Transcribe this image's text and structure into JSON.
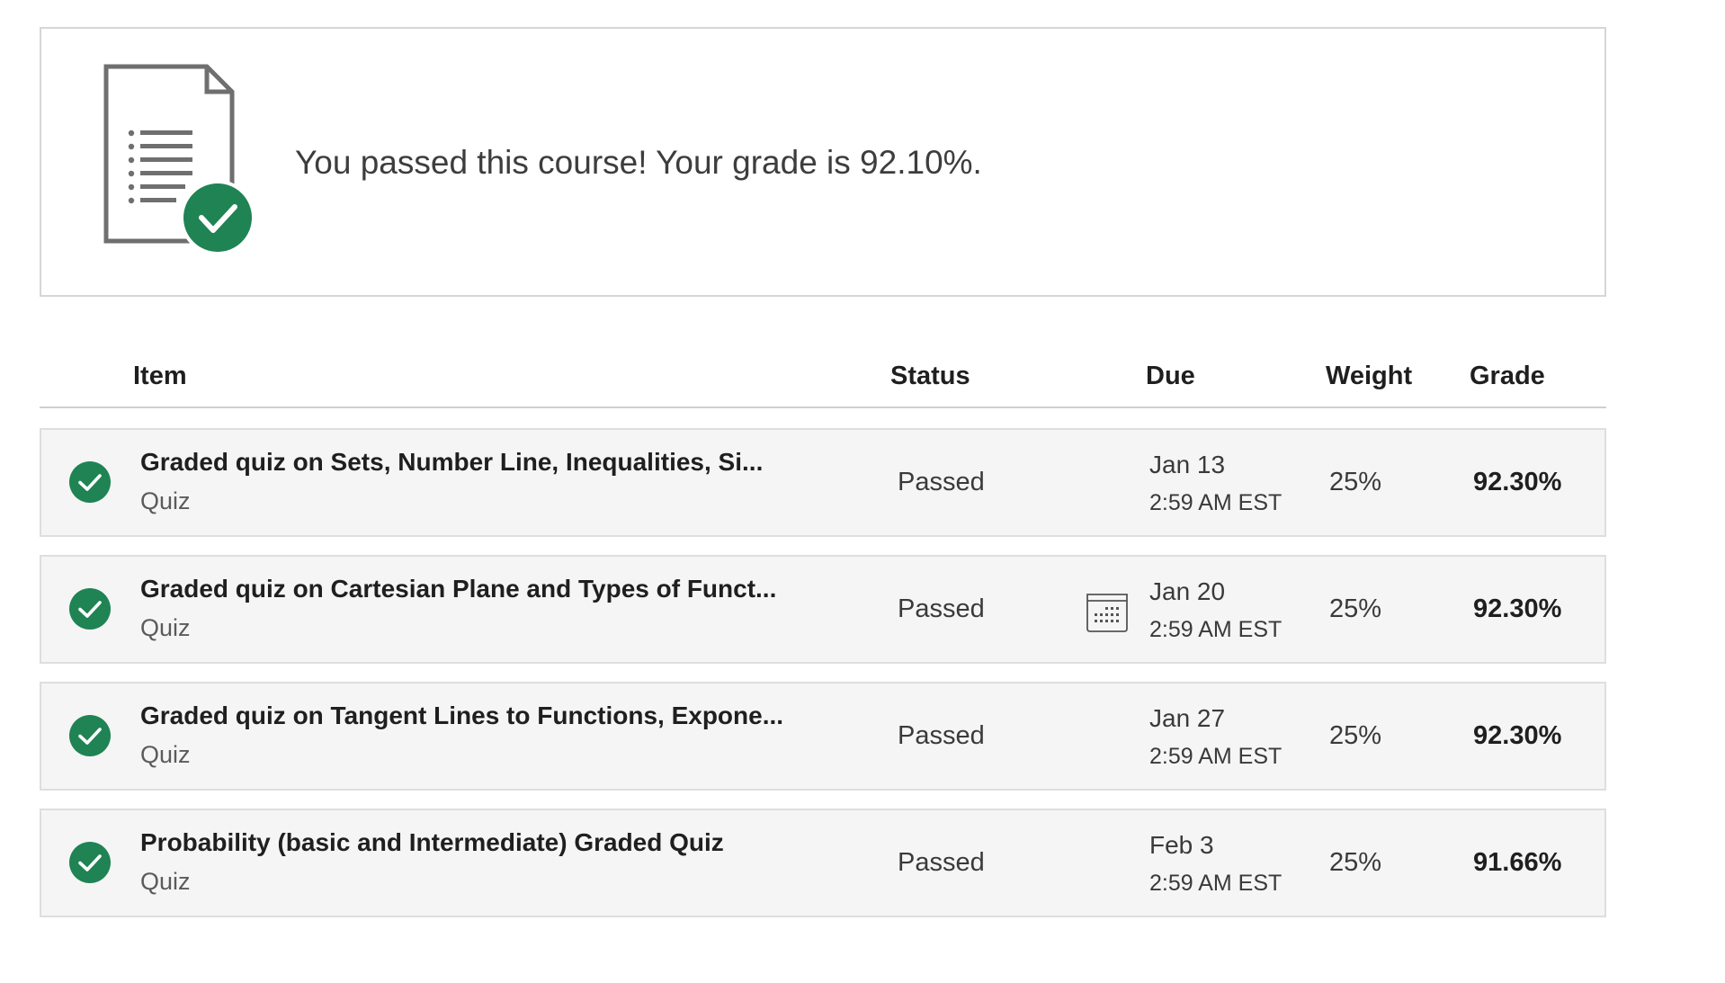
{
  "colors": {
    "accent_green": "#1f8354",
    "icon_gray": "#6f6f6f"
  },
  "banner": {
    "icon": "document-checklist-icon",
    "badge_icon": "check-circle-icon",
    "message": "You passed this course! Your grade is 92.10%."
  },
  "table": {
    "headers": {
      "item": "Item",
      "status": "Status",
      "due": "Due",
      "weight": "Weight",
      "grade": "Grade"
    },
    "rows": [
      {
        "title": "Graded quiz on Sets, Number Line, Inequalities, Si...",
        "type": "Quiz",
        "status": "Passed",
        "due_date": "Jan 13",
        "due_time": "2:59 AM EST",
        "weight": "25%",
        "grade": "92.30%",
        "icon": "check-circle-icon"
      },
      {
        "title": "Graded quiz on Cartesian Plane and Types of Funct...",
        "type": "Quiz",
        "status": "Passed",
        "due_date": "Jan 20",
        "due_time": "2:59 AM EST",
        "weight": "25%",
        "grade": "92.30%",
        "icon": "check-circle-icon",
        "due_icon": "calendar-icon"
      },
      {
        "title": "Graded quiz on Tangent Lines to Functions, Expone...",
        "type": "Quiz",
        "status": "Passed",
        "due_date": "Jan 27",
        "due_time": "2:59 AM EST",
        "weight": "25%",
        "grade": "92.30%",
        "icon": "check-circle-icon"
      },
      {
        "title": "Probability (basic and Intermediate) Graded Quiz",
        "type": "Quiz",
        "status": "Passed",
        "due_date": "Feb 3",
        "due_time": "2:59 AM EST",
        "weight": "25%",
        "grade": "91.66%",
        "icon": "check-circle-icon"
      }
    ]
  }
}
